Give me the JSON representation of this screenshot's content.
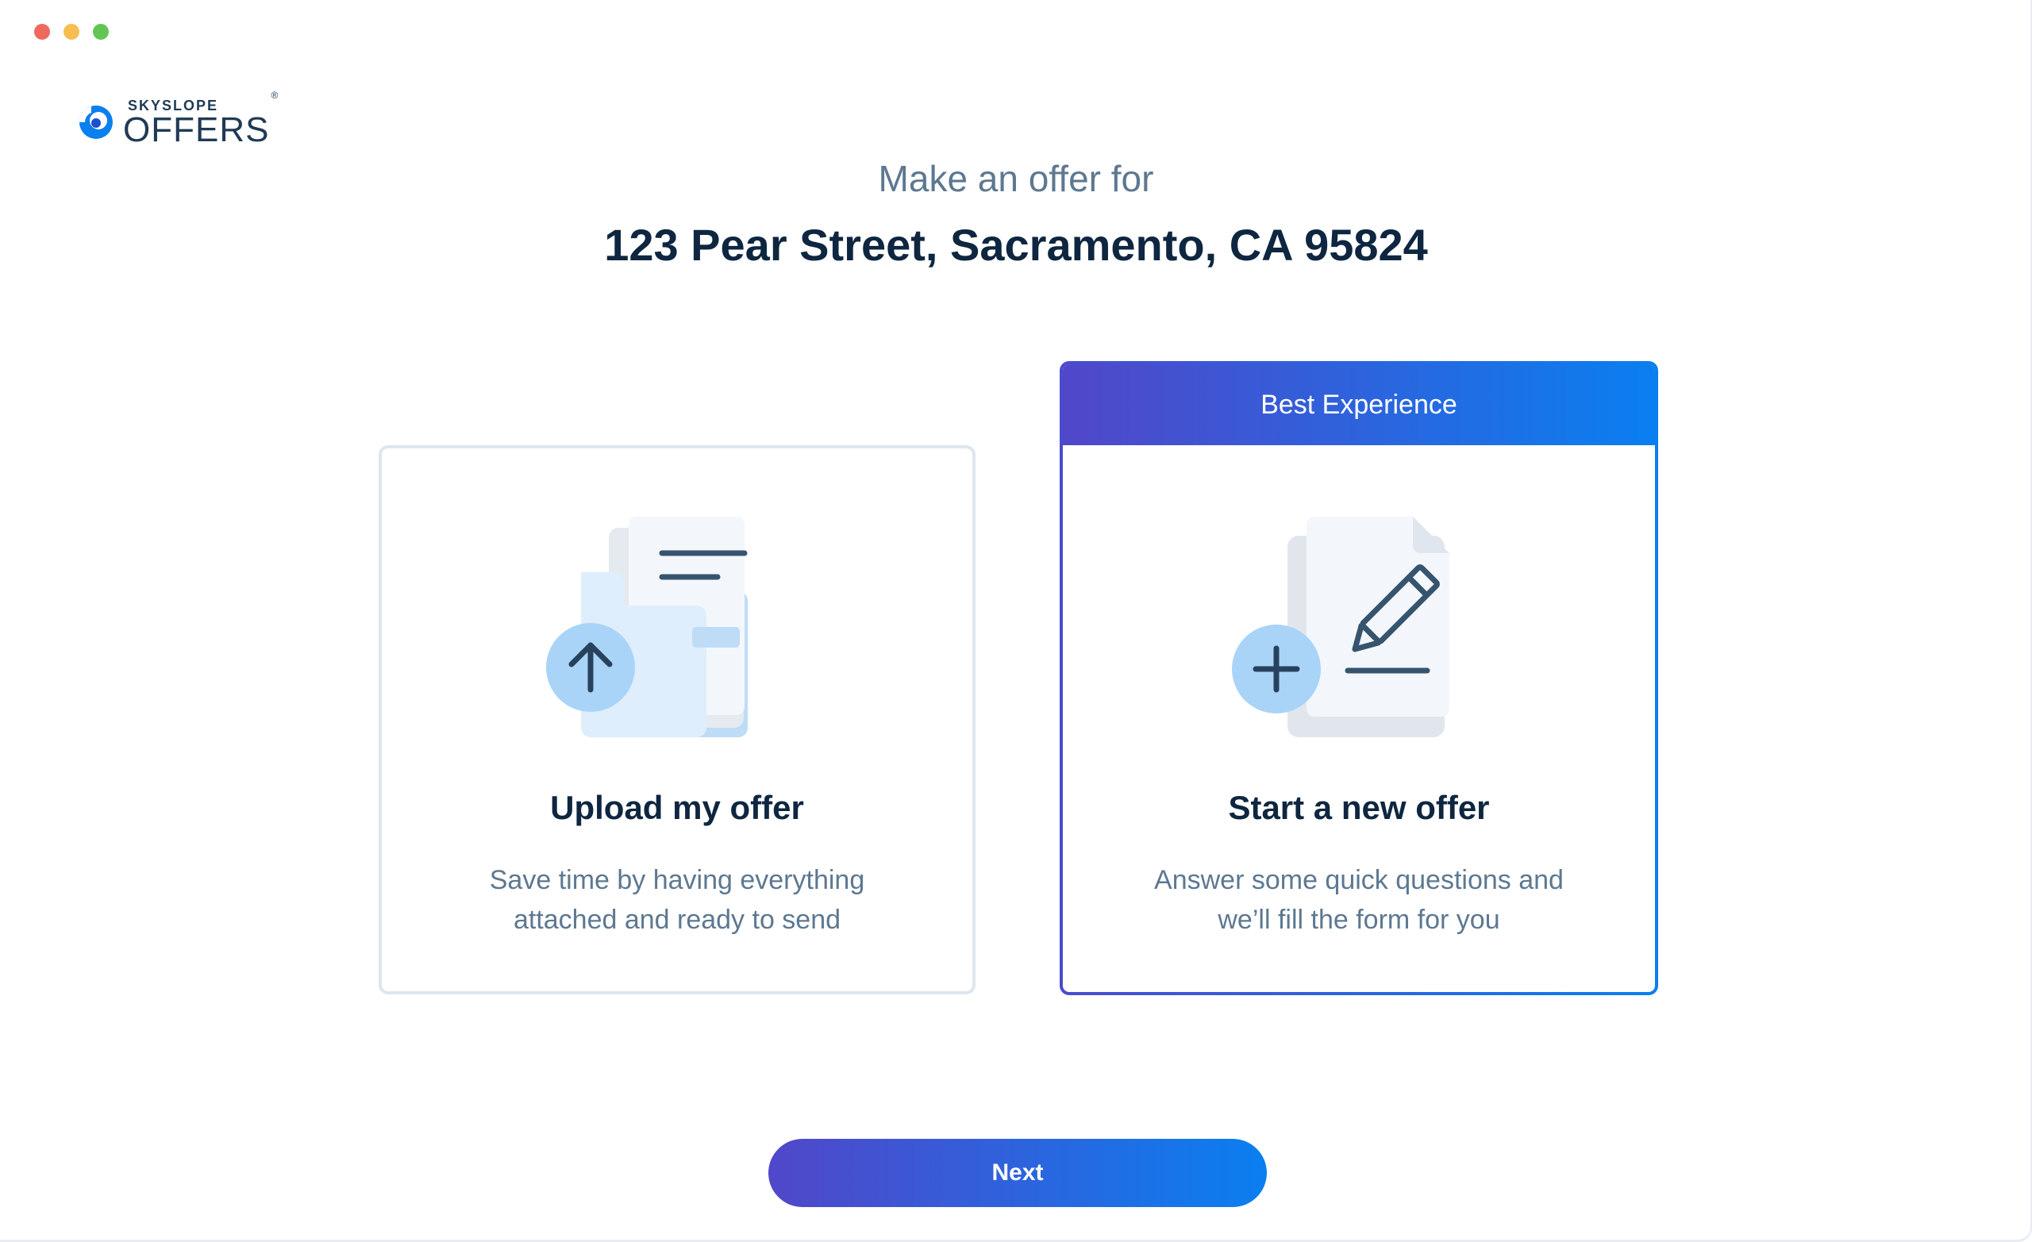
{
  "window": {
    "controls": [
      "close",
      "minimize",
      "zoom"
    ]
  },
  "brand": {
    "small": "SKYSLOPE",
    "big": "OFFERS",
    "reg": "®"
  },
  "header": {
    "subtitle": "Make an offer for",
    "address": "123 Pear Street, Sacramento, CA 95824"
  },
  "options": {
    "upload": {
      "title": "Upload my offer",
      "description_line1": "Save time by having everything",
      "description_line2": "attached and ready to send",
      "icon": "upload-document-icon"
    },
    "new_offer": {
      "badge": "Best Experience",
      "title": "Start a new offer",
      "description_line1": "Answer some quick questions and",
      "description_line2": "we’ll fill the form for you",
      "icon": "new-document-edit-icon",
      "selected": true
    }
  },
  "footer": {
    "next_label": "Next"
  },
  "colors": {
    "gradient_start": "#5147c9",
    "gradient_end": "#0a7ff0",
    "heading": "#0e2640",
    "muted_text": "#5d7891",
    "card_border": "#dde6ef"
  }
}
